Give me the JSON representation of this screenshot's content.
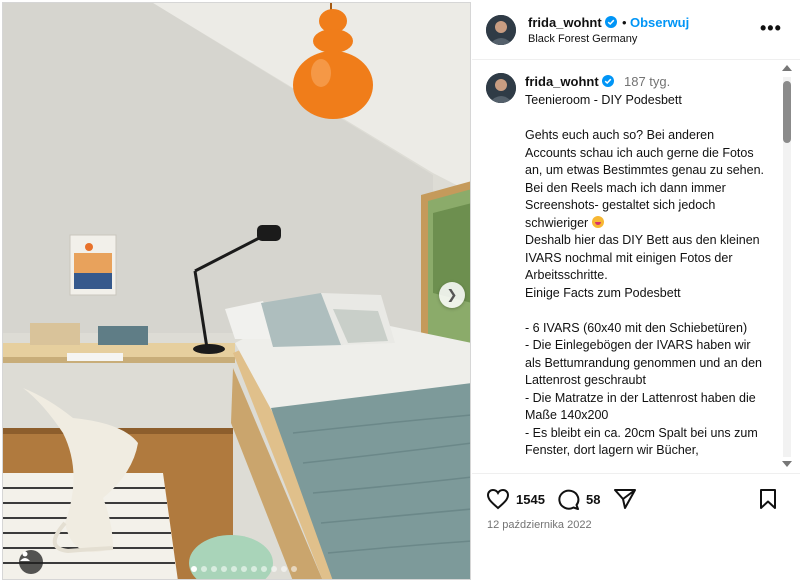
{
  "post": {
    "username": "frida_wohnt",
    "separator": "•",
    "follow_label": "Obserwuj",
    "location": "Black Forest Germany",
    "more_label": "•••"
  },
  "caption": {
    "username": "frida_wohnt",
    "age": "187 tyg.",
    "lines": [
      "Teenieroom - DIY Podesbett",
      "",
      "Gehts euch auch so? Bei anderen Accounts schau ich auch gerne die Fotos an, um etwas Bestimmtes genau zu sehen.",
      "Bei den Reels mach ich dann immer Screenshots- gestaltet sich jedoch schwieriger",
      "Deshalb hier das DIY Bett aus den kleinen IVARS nochmal mit einigen Fotos der Arbeitsschritte.",
      "Einige Facts zum Podesbett",
      "",
      "- 6 IVARS (60x40 mit den Schiebetüren)",
      "- Die Einlegebögen der IVARS haben wir als Bettumrandung genommen und an den Lattenrost geschraubt",
      "- Die Matratze in der Lattenrost haben die Maße 140x200",
      "- Es bleibt ein ca. 20cm Spalt bei uns zum Fenster, dort lagern wir Bücher,"
    ]
  },
  "actions": {
    "likes": "1545",
    "comments": "58",
    "date": "12 października 2022"
  },
  "carousel": {
    "slide_count": 11,
    "active_index": 0
  },
  "colors": {
    "accent": "#0095f6",
    "verified": "#0095f6",
    "muted": "#737373",
    "lamp": "#f07d1a"
  }
}
